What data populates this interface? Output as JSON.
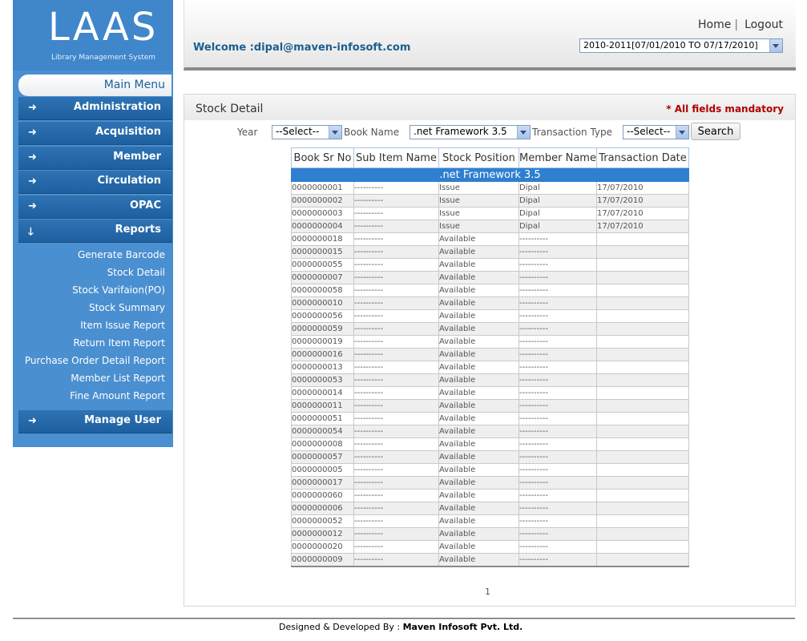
{
  "logo": {
    "text": "LAAS",
    "subtitle": "Library Management System"
  },
  "sidebar": {
    "main_menu": "Main Menu",
    "items": [
      {
        "label": "Administration"
      },
      {
        "label": "Acquisition"
      },
      {
        "label": "Member"
      },
      {
        "label": "Circulation"
      },
      {
        "label": "OPAC"
      },
      {
        "label": "Reports"
      },
      {
        "label": "Manage User"
      }
    ],
    "reports_submenu": [
      "Generate Barcode",
      "Stock Detail",
      "Stock Varifaion(PO)",
      "Stock Summary",
      "Item Issue Report",
      "Return Item Report",
      "Purchase Order Detail Report",
      "Member List Report",
      "Fine Amount Report"
    ]
  },
  "header": {
    "welcome": "Welcome :dipal@maven-infosoft.com",
    "home": "Home",
    "separator": "|",
    "logout": "Logout",
    "session_year": "2010-2011[07/01/2010 TO 07/17/2010]"
  },
  "page": {
    "title": "Stock Detail",
    "mandatory_note": "* All fields mandatory"
  },
  "filters": {
    "year_label": "Year",
    "year_value": "--Select--",
    "book_label": "Book Name",
    "book_value": ".net Framework 3.5",
    "type_label": "Transaction Type",
    "type_value": "--Select--",
    "search_label": "Search"
  },
  "table": {
    "headers": [
      "Book Sr No",
      "Sub Item Name",
      "Stock Position",
      "Member Name",
      "Transaction Date"
    ],
    "group_title": ".net Framework 3.5",
    "rows": [
      [
        "0000000001",
        "----------",
        "Issue",
        "Dipal",
        "17/07/2010"
      ],
      [
        "0000000002",
        "----------",
        "Issue",
        "Dipal",
        "17/07/2010"
      ],
      [
        "0000000003",
        "----------",
        "Issue",
        "Dipal",
        "17/07/2010"
      ],
      [
        "0000000004",
        "----------",
        "Issue",
        "Dipal",
        "17/07/2010"
      ],
      [
        "0000000018",
        "----------",
        "Available",
        "----------",
        ""
      ],
      [
        "0000000015",
        "----------",
        "Available",
        "----------",
        ""
      ],
      [
        "0000000055",
        "----------",
        "Available",
        "----------",
        ""
      ],
      [
        "0000000007",
        "----------",
        "Available",
        "----------",
        ""
      ],
      [
        "0000000058",
        "----------",
        "Available",
        "----------",
        ""
      ],
      [
        "0000000010",
        "----------",
        "Available",
        "----------",
        ""
      ],
      [
        "0000000056",
        "----------",
        "Available",
        "----------",
        ""
      ],
      [
        "0000000059",
        "----------",
        "Available",
        "----------",
        ""
      ],
      [
        "0000000019",
        "----------",
        "Available",
        "----------",
        ""
      ],
      [
        "0000000016",
        "----------",
        "Available",
        "----------",
        ""
      ],
      [
        "0000000013",
        "----------",
        "Available",
        "----------",
        ""
      ],
      [
        "0000000053",
        "----------",
        "Available",
        "----------",
        ""
      ],
      [
        "0000000014",
        "----------",
        "Available",
        "----------",
        ""
      ],
      [
        "0000000011",
        "----------",
        "Available",
        "----------",
        ""
      ],
      [
        "0000000051",
        "----------",
        "Available",
        "----------",
        ""
      ],
      [
        "0000000054",
        "----------",
        "Available",
        "----------",
        ""
      ],
      [
        "0000000008",
        "----------",
        "Available",
        "----------",
        ""
      ],
      [
        "0000000057",
        "----------",
        "Available",
        "----------",
        ""
      ],
      [
        "0000000005",
        "----------",
        "Available",
        "----------",
        ""
      ],
      [
        "0000000017",
        "----------",
        "Available",
        "----------",
        ""
      ],
      [
        "0000000060",
        "----------",
        "Available",
        "----------",
        ""
      ],
      [
        "0000000006",
        "----------",
        "Available",
        "----------",
        ""
      ],
      [
        "0000000052",
        "----------",
        "Available",
        "----------",
        ""
      ],
      [
        "0000000012",
        "----------",
        "Available",
        "----------",
        ""
      ],
      [
        "0000000020",
        "----------",
        "Available",
        "----------",
        ""
      ],
      [
        "0000000009",
        "----------",
        "Available",
        "----------",
        ""
      ]
    ]
  },
  "pager": {
    "current": "1"
  },
  "footer": {
    "prefix": "Designed & Developed By :",
    "company": "Maven Infosoft Pvt. Ltd."
  },
  "colors": {
    "sidebar": "#4a8fd0",
    "menu_item": "#2e73b4",
    "group_row": "#2f7fd0",
    "mandatory": "#b00000"
  }
}
